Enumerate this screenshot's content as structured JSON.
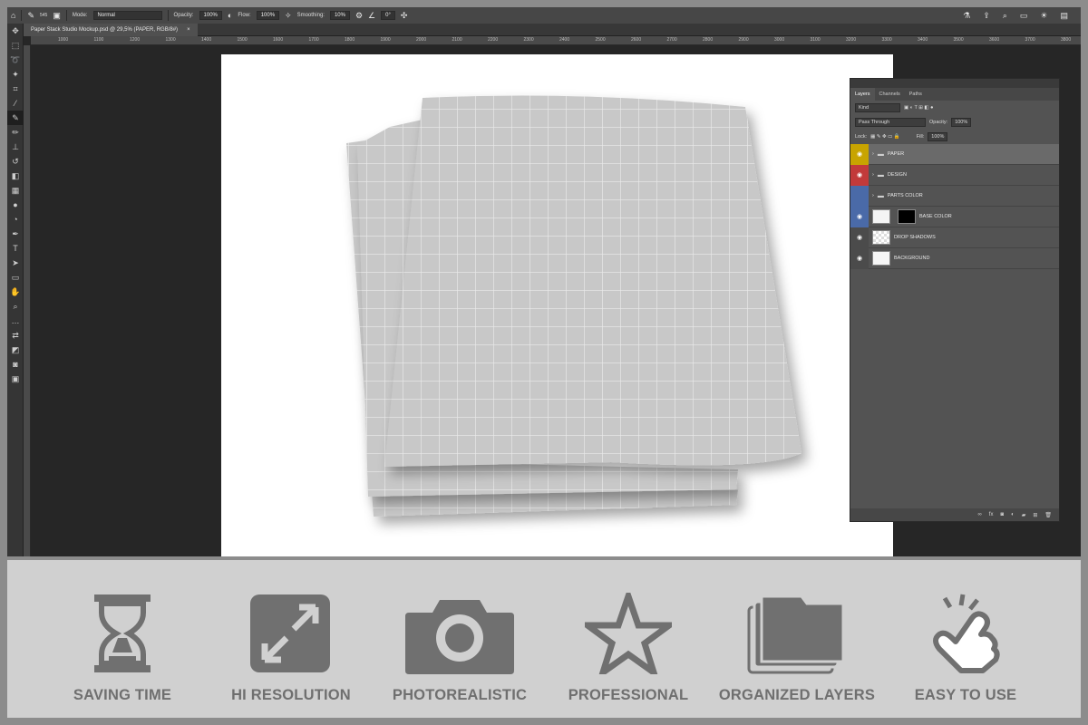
{
  "app": {
    "options_bar": {
      "brush_size": "545",
      "mode_label": "Mode:",
      "mode_value": "Normal",
      "opacity_label": "Opacity:",
      "opacity_value": "100%",
      "flow_label": "Flow:",
      "flow_value": "100%",
      "smoothing_label": "Smoothing:",
      "smoothing_value": "10%",
      "angle_value": "0°"
    },
    "document_tab": {
      "title": "Paper Stack Studio Mockup.psd @ 29,5% (PAPER, RGB/8#)",
      "close": "×"
    },
    "ruler_ticks": [
      "1000",
      "1100",
      "1200",
      "1300",
      "1400",
      "1500",
      "1600",
      "1700",
      "1800",
      "1900",
      "2000",
      "2100",
      "2200",
      "2300",
      "2400",
      "2500",
      "2600",
      "2700",
      "2800",
      "2900",
      "3000",
      "3100",
      "3200",
      "3300",
      "3400",
      "3500",
      "3600",
      "3700",
      "3800"
    ]
  },
  "layers_panel": {
    "tabs": [
      "Layers",
      "Channels",
      "Paths"
    ],
    "filter_kind": "Kind",
    "blend_mode": "Pass Through",
    "opacity_label": "Opacity:",
    "opacity_value": "100%",
    "lock_label": "Lock:",
    "fill_label": "Fill:",
    "fill_value": "100%",
    "layers": [
      {
        "name": "PAPER",
        "type": "group",
        "color": "#c8a400",
        "visible": true
      },
      {
        "name": "DESIGN",
        "type": "group",
        "color": "#c23a3a",
        "visible": true
      },
      {
        "name": "PARTS COLOR",
        "type": "group",
        "color": "#4a6aa8",
        "visible": false
      },
      {
        "name": "BASE COLOR",
        "type": "layer",
        "color": "#4a6aa8",
        "visible": true
      },
      {
        "name": "DROP SHADOWS",
        "type": "layer",
        "color": "",
        "visible": true
      },
      {
        "name": "BACKGROUND",
        "type": "layer",
        "color": "",
        "visible": true
      }
    ]
  },
  "features": [
    {
      "label": "SAVING TIME",
      "icon": "hourglass-icon"
    },
    {
      "label": "HI RESOLUTION",
      "icon": "expand-icon"
    },
    {
      "label": "PHOTOREALISTIC",
      "icon": "camera-icon"
    },
    {
      "label": "PROFESSIONAL",
      "icon": "star-icon"
    },
    {
      "label": "ORGANIZED LAYERS",
      "icon": "layers-icon"
    },
    {
      "label": "EASY TO USE",
      "icon": "hand-pointer-icon"
    }
  ],
  "colors": {
    "feature_icon": "#707070",
    "feature_bg": "#d0d0d0",
    "frame": "#8c8c8c"
  }
}
